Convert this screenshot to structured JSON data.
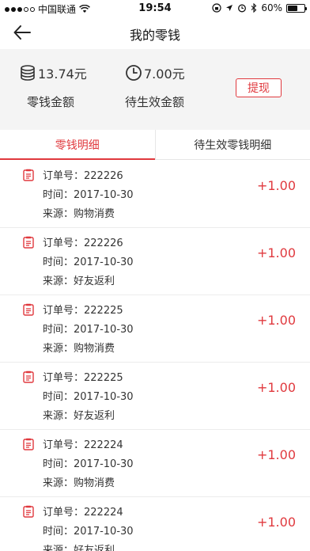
{
  "status_bar": {
    "carrier": "中国联通",
    "time": "19:54",
    "battery": "60%"
  },
  "nav": {
    "title": "我的零钱"
  },
  "summary": {
    "balance_value": "13.74元",
    "balance_label": "零钱金额",
    "pending_value": "7.00元",
    "pending_label": "待生效金额",
    "withdraw_label": "提现"
  },
  "tabs": [
    {
      "label": "零钱明细",
      "active": true
    },
    {
      "label": "待生效零钱明细",
      "active": false
    }
  ],
  "records": [
    {
      "order": "订单号：222226",
      "time": "时间：2017-10-30",
      "source": "来源：购物消费",
      "amount": "+1.00"
    },
    {
      "order": "订单号：222226",
      "time": "时间：2017-10-30",
      "source": "来源：好友返利",
      "amount": "+1.00"
    },
    {
      "order": "订单号：222225",
      "time": "时间：2017-10-30",
      "source": "来源：购物消费",
      "amount": "+1.00"
    },
    {
      "order": "订单号：222225",
      "time": "时间：2017-10-30",
      "source": "来源：好友返利",
      "amount": "+1.00"
    },
    {
      "order": "订单号：222224",
      "time": "时间：2017-10-30",
      "source": "来源：购物消费",
      "amount": "+1.00"
    },
    {
      "order": "订单号：222224",
      "time": "时间：2017-10-30",
      "source": "来源：好友返利",
      "amount": "+1.00"
    }
  ],
  "colors": {
    "accent": "#e0393e",
    "summary_bg": "#f4f4f4"
  }
}
